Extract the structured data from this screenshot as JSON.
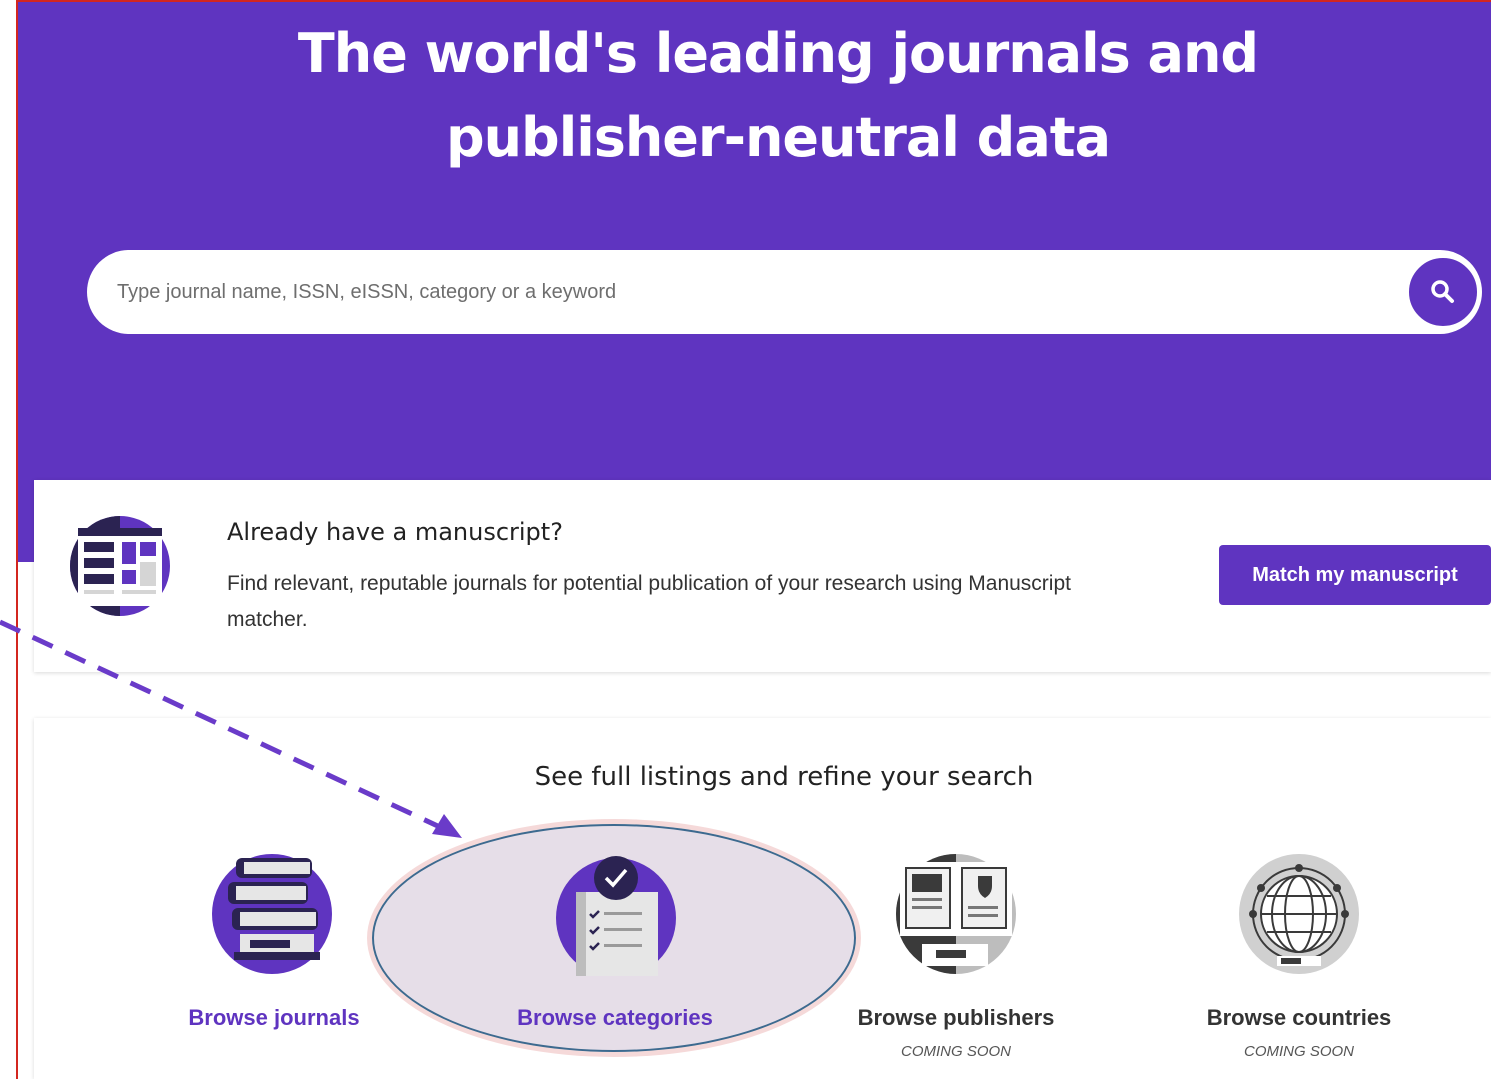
{
  "hero": {
    "title_line1": "The world's leading journals and",
    "title_line2": "publisher-neutral data"
  },
  "search": {
    "placeholder": "Type journal name, ISSN, eISSN, category or a keyword",
    "icon": "search-icon"
  },
  "manuscript": {
    "heading": "Already have a manuscript?",
    "description": "Find relevant, reputable journals for potential publication of your research using Manuscript matcher.",
    "button_label": "Match my manuscript",
    "icon": "manuscript-icon"
  },
  "browse": {
    "heading": "See full listings and refine your search",
    "items": [
      {
        "label": "Browse journals",
        "note": "",
        "icon": "journals-stack-icon"
      },
      {
        "label": "Browse categories",
        "note": "",
        "icon": "categories-checklist-icon"
      },
      {
        "label": "Browse publishers",
        "note": "COMING SOON",
        "icon": "publishers-book-icon"
      },
      {
        "label": "Browse countries",
        "note": "COMING SOON",
        "icon": "countries-globe-icon"
      }
    ]
  },
  "colors": {
    "brand_purple": "#5f34c0",
    "highlight_fill": "#dcd0de",
    "highlight_stroke": "#3d6a8f",
    "frame_red": "#d3261f"
  }
}
